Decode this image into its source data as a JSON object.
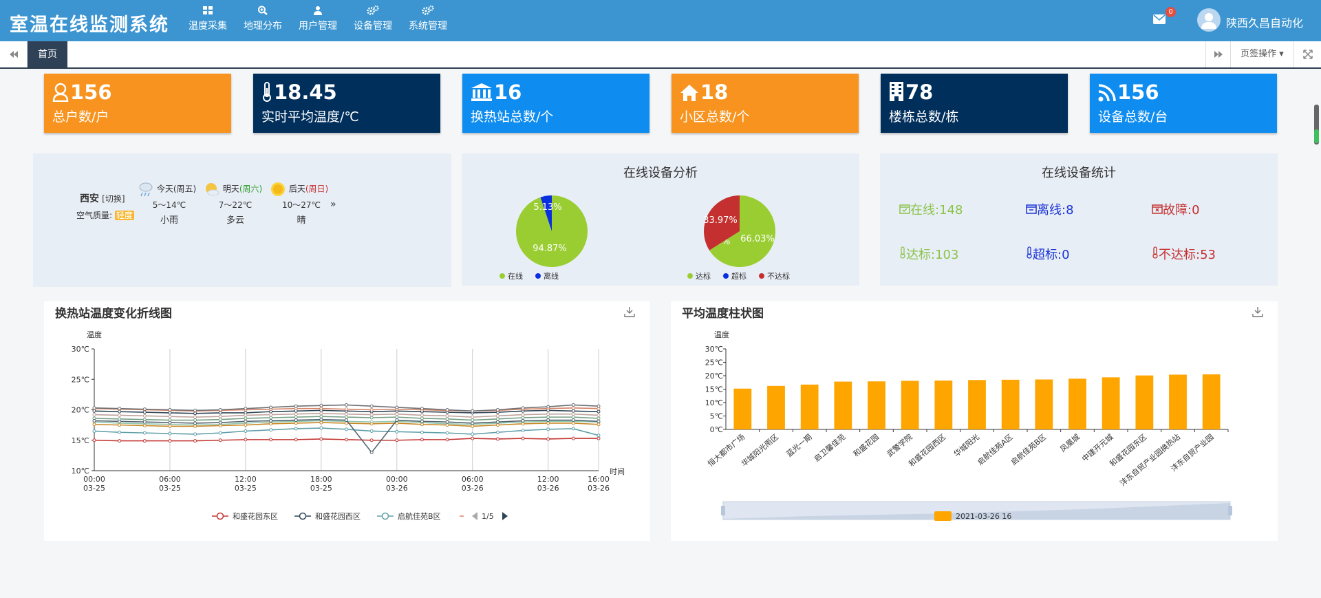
{
  "header": {
    "title": "室温在线监测系统",
    "nav": [
      "温度采集",
      "地理分布",
      "用户管理",
      "设备管理",
      "系统管理"
    ],
    "mail_count": "0",
    "user": "陕西久昌自动化"
  },
  "tabs": {
    "home": "首页",
    "ops": "页签操作"
  },
  "stats": [
    {
      "value": "156",
      "label": "总户数/户",
      "color": "#f7931e",
      "icon": "user-icon"
    },
    {
      "value": "18.45",
      "label": "实时平均温度/℃",
      "color": "#002f5c",
      "icon": "thermometer-icon"
    },
    {
      "value": "16",
      "label": "换热站总数/个",
      "color": "#0e8cf0",
      "icon": "bank-icon"
    },
    {
      "value": "18",
      "label": "小区总数/个",
      "color": "#f7931e",
      "icon": "home-icon"
    },
    {
      "value": "78",
      "label": "楼栋总数/栋",
      "color": "#002f5c",
      "icon": "building-icon"
    },
    {
      "value": "156",
      "label": "设备总数/台",
      "color": "#0e8cf0",
      "icon": "rss-icon"
    }
  ],
  "weather": {
    "city": "西安",
    "switch": "[切换]",
    "aq_label": "空气质量:",
    "aq_value": "轻度",
    "days": [
      {
        "name": "今天",
        "week": "(周五)",
        "temp": "5～14℃",
        "desc": "小雨",
        "icon": "rain-cloud-icon"
      },
      {
        "name": "明天",
        "week": "(周六)",
        "temp": "7～22℃",
        "desc": "多云",
        "icon": "sun-cloud-icon"
      },
      {
        "name": "后天",
        "week": "(周日)",
        "temp": "10～27℃",
        "desc": "晴",
        "icon": "sun-icon"
      }
    ],
    "more": "»"
  },
  "analysis": {
    "title": "在线设备分析",
    "pie1": {
      "slices": [
        {
          "name": "在线",
          "value": 94.87,
          "label": "94.87%",
          "color": "#9acd32"
        },
        {
          "name": "离线",
          "value": 5.13,
          "label": "5.13%",
          "color": "#0a2fe0"
        }
      ]
    },
    "pie2": {
      "slices": [
        {
          "name": "达标",
          "value": 66.03,
          "label": "66.03%",
          "color": "#9acd32"
        },
        {
          "name": "超标",
          "value": 0,
          "label": "0%",
          "color": "#0a2fe0"
        },
        {
          "name": "不达标",
          "value": 33.97,
          "label": "33.97%",
          "color": "#c4302f"
        }
      ]
    }
  },
  "stats2": {
    "title": "在线设备统计",
    "items": [
      {
        "label": "在线:148",
        "color": "#8bc34a",
        "icon": "calendar-check-icon"
      },
      {
        "label": "离线:8",
        "color": "#1a33d6",
        "icon": "calendar-minus-icon"
      },
      {
        "label": "故障:0",
        "color": "#c4302f",
        "icon": "calendar-x-icon"
      },
      {
        "label": "达标:103",
        "color": "#8bc34a",
        "icon": "thermometer-icon"
      },
      {
        "label": "超标:0",
        "color": "#1a33d6",
        "icon": "thermometer-icon"
      },
      {
        "label": "不达标:53",
        "color": "#c4302f",
        "icon": "thermometer-icon"
      }
    ]
  },
  "line_chart": {
    "title": "换热站温度变化折线图",
    "ylabel": "温度",
    "xlabel": "时间",
    "yticks": [
      "10℃",
      "15℃",
      "20℃",
      "25℃",
      "30℃"
    ],
    "xticks": [
      [
        "00:00",
        "03-25"
      ],
      [
        "06:00",
        "03-25"
      ],
      [
        "12:00",
        "03-25"
      ],
      [
        "18:00",
        "03-25"
      ],
      [
        "00:00",
        "03-26"
      ],
      [
        "06:00",
        "03-26"
      ],
      [
        "12:00",
        "03-26"
      ],
      [
        "16:00",
        "03-26"
      ]
    ],
    "legend": [
      "和盛花园东区",
      "和盛花园西区",
      "启航佳苑B区"
    ],
    "page": "1/5"
  },
  "chart_data": [
    {
      "type": "line",
      "ylabel": "温度",
      "xlabel": "时间",
      "ylim": [
        10,
        30
      ],
      "x": [
        "03-25 00:00",
        "03-25 02:00",
        "03-25 04:00",
        "03-25 06:00",
        "03-25 08:00",
        "03-25 10:00",
        "03-25 12:00",
        "03-25 14:00",
        "03-25 16:00",
        "03-25 18:00",
        "03-25 20:00",
        "03-25 22:00",
        "03-26 00:00",
        "03-26 02:00",
        "03-26 04:00",
        "03-26 06:00",
        "03-26 08:00",
        "03-26 10:00",
        "03-26 12:00",
        "03-26 14:00",
        "03-26 16:00"
      ],
      "series": [
        {
          "name": "和盛花园东区",
          "color": "#c23531",
          "values": [
            15.0,
            14.9,
            14.9,
            14.9,
            14.9,
            15.0,
            15.1,
            15.1,
            15.1,
            15.2,
            15.1,
            15.0,
            15.0,
            15.1,
            15.1,
            15.3,
            15.2,
            15.3,
            15.2,
            15.3,
            15.3
          ]
        },
        {
          "name": "和盛花园西区",
          "color": "#2f4554",
          "values": [
            19.8,
            19.7,
            19.6,
            19.5,
            19.4,
            19.5,
            19.5,
            19.7,
            19.8,
            19.9,
            19.8,
            19.7,
            19.8,
            19.7,
            19.6,
            19.5,
            19.6,
            19.8,
            19.9,
            19.8,
            19.7
          ]
        },
        {
          "name": "启航佳苑B区",
          "color": "#61a0a8",
          "values": [
            16.5,
            16.3,
            16.2,
            16.1,
            16.0,
            16.2,
            16.5,
            16.7,
            16.9,
            17.0,
            16.8,
            16.5,
            16.4,
            16.3,
            16.2,
            16.0,
            16.3,
            16.6,
            16.8,
            16.9,
            15.8
          ]
        },
        {
          "color": "#d48265",
          "values": [
            20.2,
            20.1,
            20.0,
            19.9,
            19.8,
            19.9,
            20.0,
            20.1,
            20.2,
            20.2,
            20.1,
            20.0,
            20.1,
            20.0,
            19.9,
            19.8,
            19.9,
            20.1,
            20.2,
            20.3,
            20.2
          ]
        },
        {
          "color": "#91c7ae",
          "values": [
            18.0,
            17.8,
            17.7,
            17.6,
            17.5,
            17.6,
            17.8,
            18.0,
            18.1,
            18.2,
            18.1,
            18.0,
            18.1,
            17.9,
            17.7,
            17.6,
            17.8,
            18.0,
            18.1,
            18.1,
            18.0
          ]
        },
        {
          "color": "#749f83",
          "values": [
            18.6,
            18.5,
            18.4,
            18.3,
            18.3,
            18.4,
            18.6,
            18.7,
            18.8,
            18.9,
            18.8,
            18.7,
            18.8,
            18.6,
            18.5,
            18.3,
            18.5,
            18.7,
            18.8,
            18.8,
            18.6
          ]
        },
        {
          "color": "#ca8622",
          "values": [
            17.6,
            17.5,
            17.4,
            17.3,
            17.3,
            17.4,
            17.5,
            17.7,
            17.8,
            17.9,
            17.8,
            17.7,
            17.8,
            17.6,
            17.5,
            17.3,
            17.5,
            17.7,
            17.8,
            17.8,
            17.6
          ]
        },
        {
          "color": "#bda29a",
          "values": [
            19.2,
            19.1,
            19.0,
            18.9,
            18.8,
            18.9,
            19.1,
            19.2,
            19.3,
            19.4,
            19.3,
            19.2,
            19.3,
            19.1,
            19.0,
            18.8,
            19.0,
            19.2,
            19.3,
            19.3,
            19.1
          ]
        },
        {
          "color": "#546570",
          "values": [
            18.2,
            18.1,
            18.0,
            17.9,
            17.8,
            17.9,
            18.1,
            18.2,
            18.3,
            18.4,
            18.3,
            13.0,
            18.3,
            18.1,
            18.0,
            17.8,
            18.0,
            18.2,
            18.3,
            18.3,
            18.1
          ]
        },
        {
          "color": "#6e7074",
          "values": [
            20.3,
            20.2,
            20.1,
            20.0,
            19.9,
            20.0,
            20.2,
            20.4,
            20.6,
            20.7,
            20.8,
            20.6,
            20.4,
            20.2,
            20.0,
            19.8,
            20.0,
            20.3,
            20.5,
            20.8,
            20.6
          ]
        }
      ]
    },
    {
      "type": "bar",
      "title": "平均温度柱状图",
      "ylabel": "温度",
      "ylim": [
        0,
        30
      ],
      "yticks": [
        "0℃",
        "5℃",
        "10℃",
        "15℃",
        "20℃",
        "25℃",
        "30℃"
      ],
      "categories": [
        "恒大都市广场",
        "华城阳光雨区",
        "蓝光一期",
        "启卫馨佳苑",
        "和盛花园",
        "武警学院",
        "和盛花园西区",
        "华城阳光",
        "启航佳苑A区",
        "启航佳苑B区",
        "凤凰城",
        "中建开元城",
        "和盛花园东区",
        "沣东自贸产业园换热站",
        "沣东自贸产业园"
      ],
      "values": [
        15.2,
        16.2,
        16.7,
        17.8,
        17.9,
        18.1,
        18.2,
        18.4,
        18.5,
        18.6,
        18.9,
        19.4,
        20.1,
        20.4,
        20.5
      ],
      "color": "#ffa500",
      "legend": "2021-03-26 16"
    }
  ]
}
